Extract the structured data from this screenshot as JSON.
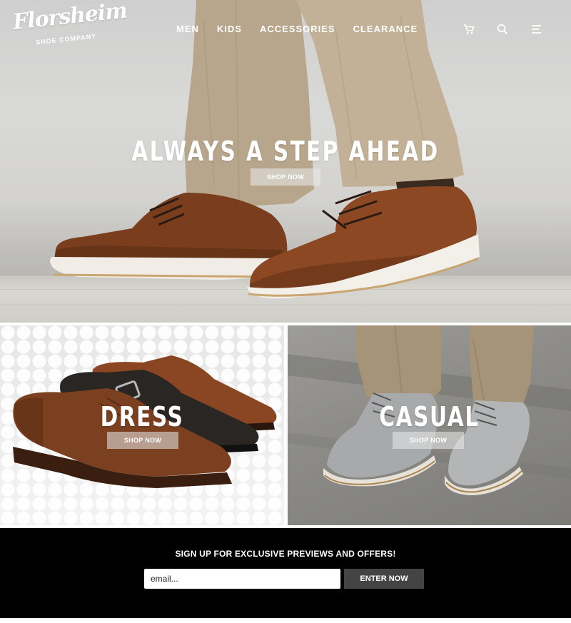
{
  "brand": {
    "script": "Florsheim",
    "sub": "SHOE COMPANY"
  },
  "nav": {
    "links": [
      "MEN",
      "KIDS",
      "ACCESSORIES",
      "CLEARANCE"
    ],
    "icons": [
      "cart-icon",
      "search-icon",
      "menu-icon"
    ]
  },
  "hero": {
    "title": "ALWAYS A STEP AHEAD",
    "button": "SHOP NOW"
  },
  "tiles": [
    {
      "title": "DRESS",
      "button": "SHOP NOW"
    },
    {
      "title": "CASUAL",
      "button": "SHOP NOW"
    }
  ],
  "signup": {
    "heading": "SIGN UP FOR EXCLUSIVE PREVIEWS AND OFFERS!",
    "placeholder": "email...",
    "button": "ENTER NOW"
  }
}
